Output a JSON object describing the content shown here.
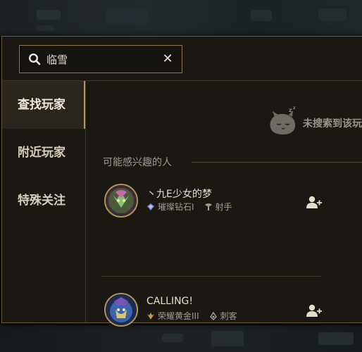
{
  "search": {
    "value": "临雪",
    "placeholder": "",
    "clear_icon": "close-icon",
    "search_icon": "search-icon"
  },
  "sidebar": {
    "items": [
      {
        "label": "查找玩家",
        "active": true
      },
      {
        "label": "附近玩家",
        "active": false
      },
      {
        "label": "特殊关注",
        "active": false
      }
    ]
  },
  "empty_state": {
    "icon": "sleeping-poro-icon",
    "text": "未搜索到该玩家"
  },
  "suggestions": {
    "title": "可能感兴趣的人",
    "players": [
      {
        "name": "丶九E少女的梦",
        "rank": "璀璨钻石I",
        "role": "射手",
        "rank_icon": "diamond-rank-icon",
        "role_icon": "marksman-icon",
        "add_icon": "add-friend-icon"
      },
      {
        "name": "CALLING!",
        "rank": "荣耀黄金III",
        "role": "刺客",
        "rank_icon": "gold-rank-icon",
        "role_icon": "assassin-icon",
        "add_icon": "add-friend-icon"
      }
    ]
  },
  "colors": {
    "accent": "#b29755",
    "panel": "#1b1813",
    "text": "#e4ded0"
  }
}
